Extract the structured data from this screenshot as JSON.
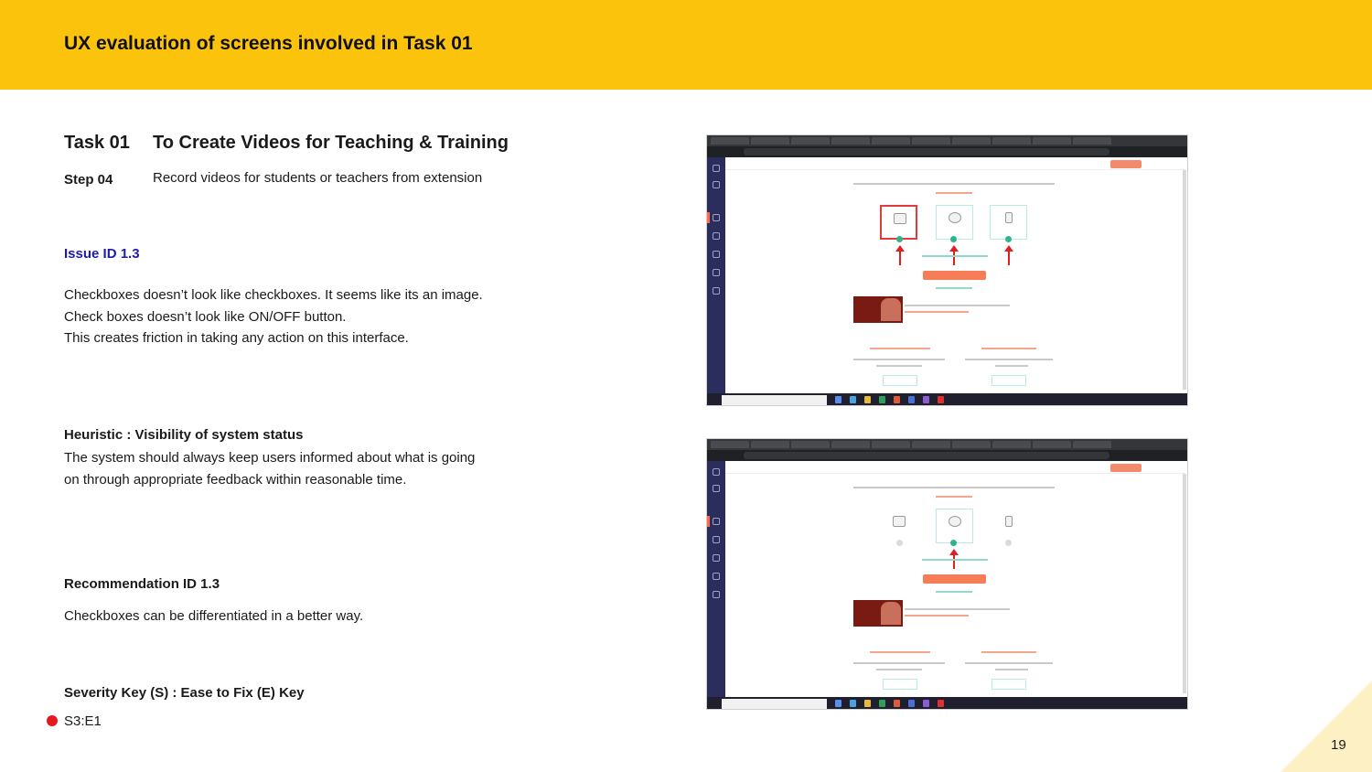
{
  "header": {
    "title": "UX evaluation of screens involved in Task 01"
  },
  "task": {
    "label": "Task 01",
    "title": "To Create Videos for Teaching & Training",
    "step_label": "Step 04",
    "step_text": "Record videos for students or teachers from extension"
  },
  "issue": {
    "id": "Issue ID 1.3",
    "lines": [
      "Checkboxes doesn’t look like checkboxes. It seems like its an image.",
      "Check boxes doesn’t look like ON/OFF button.",
      "This creates friction in taking any action on this interface."
    ]
  },
  "heuristic": {
    "title": "Heuristic : Visibility of system status",
    "text": "The system should always keep users informed about what  is going on through appropriate feedback within reasonable time."
  },
  "recommendation": {
    "title": "Recommendation ID 1.3",
    "text": "Checkboxes can be differentiated in a better way."
  },
  "severity": {
    "title": "Severity Key (S) : Ease to Fix (E) Key",
    "value": "S3:E1",
    "dot_color": "#e8161e"
  },
  "page_number": "19",
  "colors": {
    "header": "#FBC30B",
    "issue_id": "#1b1bb0",
    "corner": "#fdf0c4"
  },
  "screenshots": [
    {
      "name": "screenshot-top",
      "selected_cards": [
        "screen-recorder",
        "video-cam",
        "mic"
      ],
      "checked_cards": [
        "screen-recorder",
        "video-cam",
        "mic"
      ]
    },
    {
      "name": "screenshot-bottom",
      "selected_cards": [],
      "checked_cards": [
        "video-cam"
      ]
    }
  ]
}
